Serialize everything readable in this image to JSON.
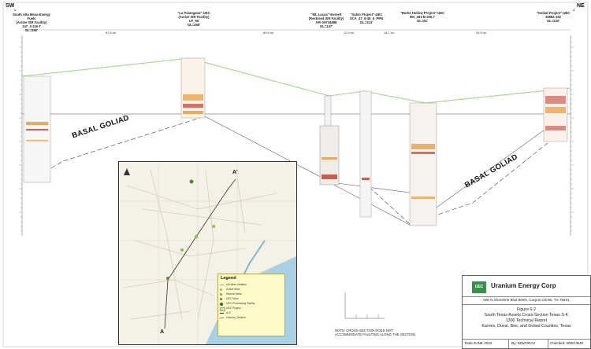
{
  "corners": {
    "left": "SW",
    "right": "NE",
    "left_sub": "A",
    "right_sub": "A'"
  },
  "wells": [
    {
      "name": "South Alta Mesa-Energy Fuels\n(Active ISR Facility)\n147_3-116-T\nGL=250'"
    },
    {
      "name": "\"La Palangana\"-UEC\n(Active ISR Facility)\nLP_56\nGL=465'"
    },
    {
      "name": "\"Mt. Lucas\"-Everett\n(Restored ISR Facility)\nAPI-29734898\nGL=147'"
    },
    {
      "name": "\"Salvo Project\"-UEC\nSCA_47_8-45_5_PPN\nGL=313'"
    },
    {
      "name": "\"Burke Hollow Project\"-UEC\nBH_281-B-335.7\nGL=91'"
    },
    {
      "name": "\"Goliad Project\"-UEC\n30882-162\nGL=234'"
    }
  ],
  "distances": [
    "91.5 mi.",
    "69.6 mi.",
    "12.6 mi.",
    "18.7 mi.",
    "41.8 mi."
  ],
  "formation_labels": [
    "BASAL GOLIAD",
    "BASAL GOLIAD"
  ],
  "section_note": "NOTE: CROSS-SECTION DOES NOT\nACCOMMODATE FAULTING ALONG THE SECTION",
  "map_points": [
    "A",
    "A'"
  ],
  "legend": {
    "title": "Legend",
    "items": [
      "roll other oblation",
      "Active Mine",
      "Historic Mine",
      "UEC Mine",
      "UEC Processing Facility",
      "UEC Project",
      "A-A'",
      "Hobson_Section"
    ]
  },
  "company": {
    "logo_text": "UEC",
    "name": "Uranium Energy Corp",
    "address": "500 N Shoreline Blvd 800N, Corpus Christi, TX 78401"
  },
  "figure": {
    "number": "Figure 6-2",
    "title": "South Texas Assets Cross-Section Texas S-K",
    "report": "1300 Technical Report",
    "location": "Karnes, Duval, Bee, and Goliad Counties, Texas"
  },
  "footer": {
    "date": "Date:JUNE 2022",
    "by": "By: WWC/RAV",
    "checked": "Checked: WWC/BJS"
  },
  "colors": {
    "ground_line": "#9fd68a",
    "well_log_red": "#c0392b",
    "well_log_orange": "#e59a3c",
    "logo_green": "#3d8f4e",
    "map_water": "#a8d1e6"
  }
}
